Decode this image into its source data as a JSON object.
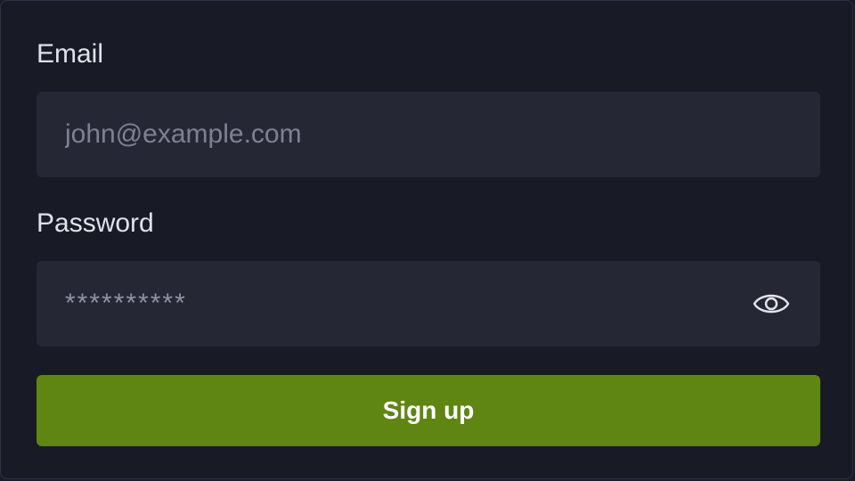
{
  "form": {
    "email": {
      "label": "Email",
      "placeholder": "john@example.com",
      "value": ""
    },
    "password": {
      "label": "Password",
      "masked_value": "**********",
      "toggle_icon": "eye-icon"
    },
    "submit_label": "Sign up"
  },
  "colors": {
    "background": "#181b26",
    "field_background": "#262734",
    "accent": "#5f8512",
    "label_text": "#dfe2ea",
    "placeholder_text": "#7d8193"
  }
}
